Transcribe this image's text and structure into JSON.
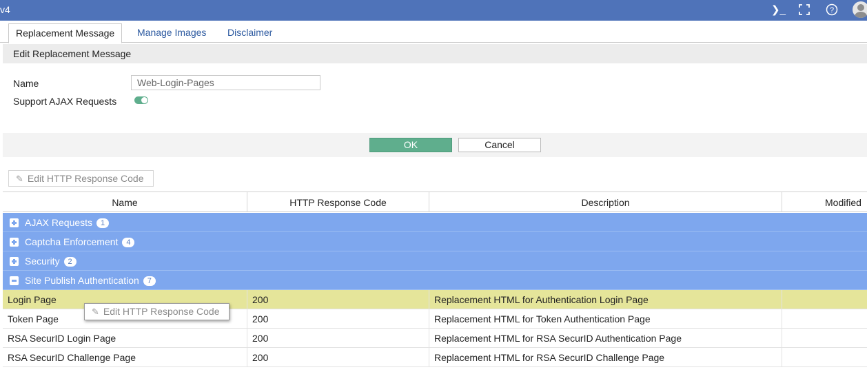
{
  "window": {
    "title": "v4"
  },
  "topbar": {
    "icons": [
      {
        "name": "terminal-icon",
        "glyph": "❯_"
      },
      {
        "name": "fullscreen-icon",
        "glyph": "⛶"
      },
      {
        "name": "help-icon",
        "glyph": "?"
      },
      {
        "name": "user-avatar-icon"
      }
    ]
  },
  "tabs": [
    {
      "label": "Replacement Message",
      "active": true
    },
    {
      "label": "Manage Images",
      "active": false
    },
    {
      "label": "Disclaimer",
      "active": false
    }
  ],
  "form": {
    "section_title": "Edit Replacement Message",
    "name_label": "Name",
    "name_value": "Web-Login-Pages",
    "ajax_label": "Support AJAX Requests",
    "ajax_enabled": true,
    "ok_label": "OK",
    "cancel_label": "Cancel"
  },
  "toolbar": {
    "edit_code_label": "Edit HTTP Response Code"
  },
  "table": {
    "columns": [
      "Name",
      "HTTP Response Code",
      "Description",
      "Modified"
    ],
    "groups": [
      {
        "name": "AJAX Requests",
        "count": "1",
        "expanded": false
      },
      {
        "name": "Captcha Enforcement",
        "count": "4",
        "expanded": false
      },
      {
        "name": "Security",
        "count": "2",
        "expanded": false
      },
      {
        "name": "Site Publish Authentication",
        "count": "7",
        "expanded": true
      }
    ],
    "rows": [
      {
        "name": "Login Page",
        "code": "200",
        "description": "Replacement HTML for Authentication Login Page",
        "modified": "",
        "selected": true
      },
      {
        "name": "Token Page",
        "code": "200",
        "description": "Replacement HTML for Token Authentication Page",
        "modified": "",
        "selected": false
      },
      {
        "name": "RSA SecurID Login Page",
        "code": "200",
        "description": "Replacement HTML for RSA SecurID Authentication Page",
        "modified": "",
        "selected": false
      },
      {
        "name": "RSA SecurID Challenge Page",
        "code": "200",
        "description": "Replacement HTML for RSA SecurID Challenge Page",
        "modified": "",
        "selected": false
      }
    ]
  },
  "context_menu": {
    "edit_code_label": "Edit HTTP Response Code"
  },
  "colors": {
    "topbar": "#4f73b9",
    "group_row": "#7ea7ee",
    "selected_row": "#e5e59a",
    "ok_button": "#5fae8d",
    "toggle_on": "#5fae8d"
  }
}
